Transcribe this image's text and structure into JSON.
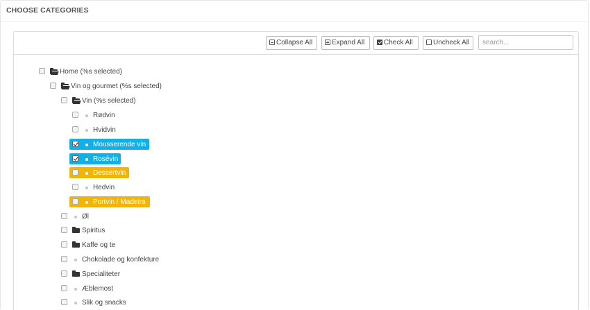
{
  "panel": {
    "title": "CHOOSE CATEGORIES"
  },
  "toolbar": {
    "collapse_label": "Collapse All",
    "expand_label": "Expand All",
    "check_label": "Check All",
    "uncheck_label": "Uncheck All",
    "search_placeholder": "search..."
  },
  "colors": {
    "selected": "#11b0e8",
    "partial": "#f2b506"
  },
  "tree": [
    {
      "label": "Home (%s selected)",
      "icon": "folder-open-icon",
      "state": "unchecked"
    },
    {
      "label": "Vin og gourmet (%s selected)",
      "icon": "folder-open-icon",
      "state": "unchecked"
    },
    {
      "label": "Vin (%s selected)",
      "icon": "folder-open-icon",
      "state": "unchecked"
    },
    {
      "label": "Rødvin",
      "icon": "dot-icon",
      "state": "unchecked"
    },
    {
      "label": "Hvidvin",
      "icon": "dot-icon",
      "state": "unchecked"
    },
    {
      "label": "Mousserende vin",
      "icon": "dot-icon",
      "state": "checked",
      "highlight": "blue"
    },
    {
      "label": "Rosévin",
      "icon": "dot-icon",
      "state": "checked",
      "highlight": "blue"
    },
    {
      "label": "Dessertvin",
      "icon": "dot-icon",
      "state": "unchecked",
      "highlight": "yellow"
    },
    {
      "label": "Hedvin",
      "icon": "dot-icon",
      "state": "unchecked"
    },
    {
      "label": "Portvin / Madeira",
      "icon": "dot-icon",
      "state": "unchecked",
      "highlight": "yellow"
    },
    {
      "label": "Øl",
      "icon": "dot-icon",
      "state": "unchecked"
    },
    {
      "label": "Spiritus",
      "icon": "folder-icon",
      "state": "unchecked"
    },
    {
      "label": "Kaffe og te",
      "icon": "folder-icon",
      "state": "unchecked"
    },
    {
      "label": "Chokolade og konfekture",
      "icon": "dot-icon",
      "state": "unchecked"
    },
    {
      "label": "Specialiteter",
      "icon": "folder-icon",
      "state": "unchecked"
    },
    {
      "label": "Æblemost",
      "icon": "dot-icon",
      "state": "unchecked"
    },
    {
      "label": "Slik og snacks",
      "icon": "dot-icon",
      "state": "unchecked"
    }
  ]
}
